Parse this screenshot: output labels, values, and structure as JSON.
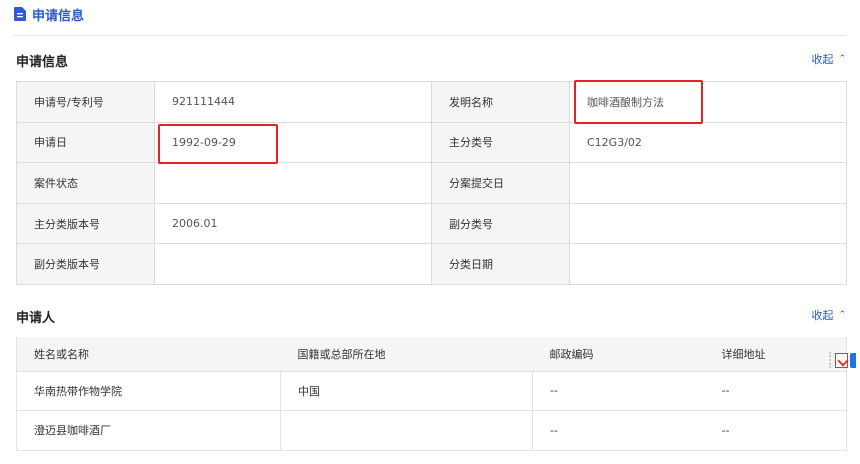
{
  "page_header": {
    "title": "申请信息",
    "icon": "document-icon"
  },
  "app_info": {
    "title": "申请信息",
    "collapse_label": "收起",
    "rows": [
      {
        "l1": "申请号/专利号",
        "v1": "921111444",
        "l2": "发明名称",
        "v2": "咖啡酒酿制方法"
      },
      {
        "l1": "申请日",
        "v1": "1992-09-29",
        "l2": "主分类号",
        "v2": "C12G3/02"
      },
      {
        "l1": "案件状态",
        "v1": "",
        "l2": "分案提交日",
        "v2": ""
      },
      {
        "l1": "主分类版本号",
        "v1": "2006.01",
        "l2": "副分类号",
        "v2": ""
      },
      {
        "l1": "副分类版本号",
        "v1": "",
        "l2": "分类日期",
        "v2": ""
      }
    ]
  },
  "applicants": {
    "title": "申请人",
    "collapse_label": "收起",
    "columns": [
      "姓名或名称",
      "国籍或总部所在地",
      "邮政编码",
      "详细地址"
    ],
    "rows": [
      [
        "华南热带作物学院",
        "中国",
        "--",
        "--"
      ],
      [
        "澄迈县咖啡酒厂",
        "",
        "--",
        "--"
      ]
    ]
  },
  "highlight_color": "#e0241f",
  "accent_color": "#2d5bcc"
}
